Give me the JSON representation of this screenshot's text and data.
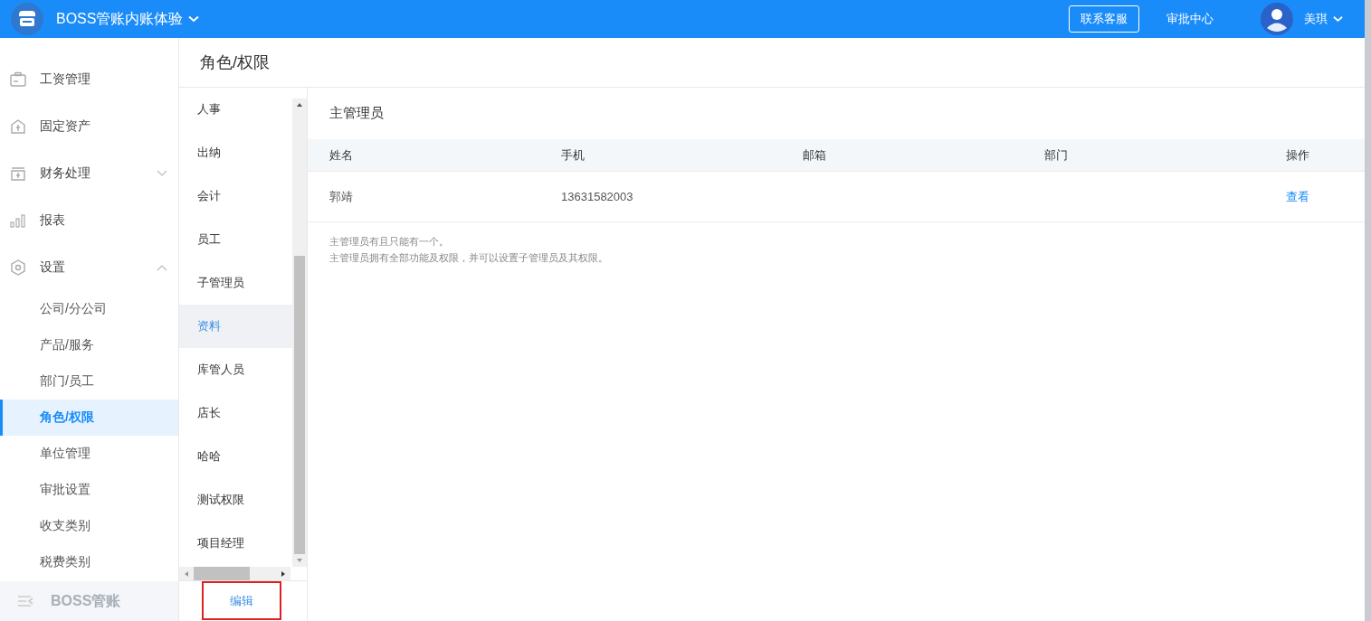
{
  "app": {
    "title": "BOSS管账内账体验"
  },
  "header": {
    "service_button": "联系客服",
    "approval_link": "审批中心",
    "user_name": "美琪"
  },
  "sidebar": {
    "items": [
      {
        "label": "工资管理",
        "selected": false
      },
      {
        "label": "固定资产",
        "selected": false
      },
      {
        "label": "财务处理",
        "selected": false,
        "expanded": false
      },
      {
        "label": "报表",
        "selected": false
      },
      {
        "label": "设置",
        "selected": false,
        "expanded": true,
        "children": [
          {
            "label": "公司/分公司",
            "selected": false
          },
          {
            "label": "产品/服务",
            "selected": false
          },
          {
            "label": "部门/员工",
            "selected": false
          },
          {
            "label": "角色/权限",
            "selected": true
          },
          {
            "label": "单位管理",
            "selected": false
          },
          {
            "label": "审批设置",
            "selected": false
          },
          {
            "label": "收支类别",
            "selected": false
          },
          {
            "label": "税费类别",
            "selected": false
          }
        ]
      }
    ],
    "footer": "BOSS管账"
  },
  "page": {
    "title": "角色/权限"
  },
  "roles": [
    {
      "label": "人事",
      "selected": false
    },
    {
      "label": "出纳",
      "selected": false
    },
    {
      "label": "会计",
      "selected": false
    },
    {
      "label": "员工",
      "selected": false
    },
    {
      "label": "子管理员",
      "selected": false
    },
    {
      "label": "资料",
      "selected": true
    },
    {
      "label": "库管人员",
      "selected": false
    },
    {
      "label": "店长",
      "selected": false
    },
    {
      "label": "哈哈",
      "selected": false
    },
    {
      "label": "测试权限",
      "selected": false
    },
    {
      "label": "项目经理",
      "selected": false
    }
  ],
  "edit_button": "编辑",
  "admin": {
    "heading": "主管理员",
    "table": {
      "columns": [
        "姓名",
        "手机",
        "邮箱",
        "部门",
        "操作"
      ],
      "rows": [
        {
          "name": "郭靖",
          "phone": "13631582003",
          "action": "查看"
        }
      ]
    },
    "notes": [
      "主管理员有且只能有一个。",
      "主管理员拥有全部功能及权限，并可以设置子管理员及其权限。"
    ]
  }
}
